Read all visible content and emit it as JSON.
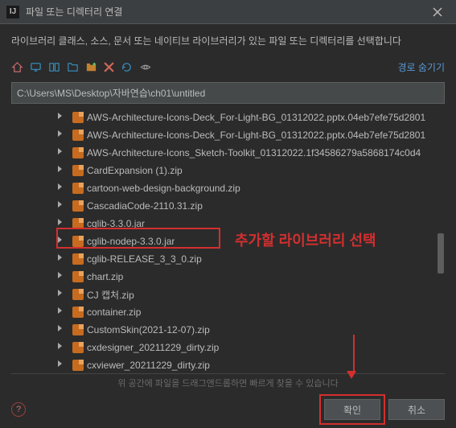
{
  "titlebar": {
    "app_icon_label": "IJ",
    "title": "파일 또는 디렉터리 연결"
  },
  "instructions": "라이브러리 클래스, 소스, 문서 또는 네이티브 라이브러리가 있는 파일 또는 디렉터리를 선택합니다",
  "toolbar": {
    "hide_path_label": "경로 숨기기"
  },
  "path": "C:\\Users\\MS\\Desktop\\자바연습\\ch01\\untitled",
  "files": [
    "AWS-Architecture-Icons-Deck_For-Light-BG_01312022.pptx.04eb7efe75d2801",
    "AWS-Architecture-Icons-Deck_For-Light-BG_01312022.pptx.04eb7efe75d2801",
    "AWS-Architecture-Icons_Sketch-Toolkit_01312022.1f34586279a5868174c0d4",
    "CardExpansion (1).zip",
    "cartoon-web-design-background.zip",
    "CascadiaCode-2110.31.zip",
    "cglib-3.3.0.jar",
    "cglib-nodep-3.3.0.jar",
    "cglib-RELEASE_3_3_0.zip",
    "chart.zip",
    "CJ 캡처.zip",
    "container.zip",
    "CustomSkin(2021-12-07).zip",
    "cxdesigner_20211229_dirty.zip",
    "cxviewer_20211229_dirty.zip"
  ],
  "highlighted_index": 7,
  "annotation_text": "추가할 라이브러리 선택",
  "hint_text": "위 공간에 파일을 드래그앤드롭하면 빠르게 찾을 수 있습니다",
  "buttons": {
    "ok": "확인",
    "cancel": "취소"
  }
}
